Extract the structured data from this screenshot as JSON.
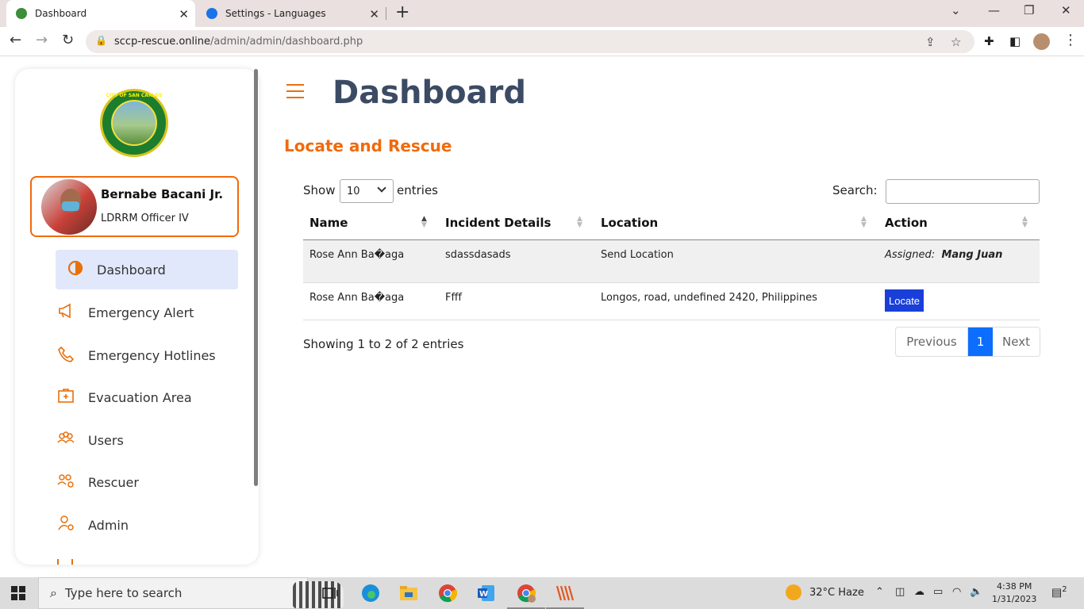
{
  "browser": {
    "tabs": [
      {
        "label": "Dashboard",
        "active": true
      },
      {
        "label": "Settings - Languages",
        "active": false
      }
    ],
    "url_domain": "sccp-rescue.online",
    "url_path": "/admin/admin/dashboard.php"
  },
  "sidebar": {
    "seal_text": "CITY OF SAN CARLOS",
    "user": {
      "name": "Bernabe Bacani Jr.",
      "role": "LDRRM Officer IV"
    },
    "items": [
      {
        "label": "Dashboard",
        "icon": "half-circle-icon",
        "active": true
      },
      {
        "label": "Emergency Alert",
        "icon": "megaphone-icon"
      },
      {
        "label": "Emergency Hotlines",
        "icon": "phone-icon"
      },
      {
        "label": "Evacuation Area",
        "icon": "first-aid-icon"
      },
      {
        "label": "Users",
        "icon": "users-group-icon"
      },
      {
        "label": "Rescuer",
        "icon": "users-gear-icon"
      },
      {
        "label": "Admin",
        "icon": "user-gear-icon"
      }
    ]
  },
  "main": {
    "title": "Dashboard",
    "section_title": "Locate and Rescue",
    "table_controls": {
      "show_label": "Show",
      "entries_value": "10",
      "entries_label": "entries",
      "search_label": "Search:",
      "search_value": ""
    },
    "columns": [
      "Name",
      "Incident Details",
      "Location",
      "Action"
    ],
    "rows": [
      {
        "name": "Rose Ann Ba�aga",
        "details": "sdassdasads",
        "location": "Send Location",
        "action_prefix": "Assigned:",
        "action_name": "Mang Juan"
      },
      {
        "name": "Rose Ann Ba�aga",
        "details": "Ffff",
        "location": "Longos, road, undefined 2420, Philippines",
        "action_button": "Locate"
      }
    ],
    "info": "Showing 1 to 2 of 2 entries",
    "pager": {
      "prev": "Previous",
      "current": "1",
      "next": "Next"
    }
  },
  "taskbar": {
    "search_placeholder": "Type here to search",
    "weather": "32°C  Haze",
    "time": "4:38 PM",
    "date": "1/31/2023",
    "notifications": "2"
  },
  "colors": {
    "accent": "#f06a0c",
    "title": "#3c4b64",
    "active_nav_bg": "#e1e8fb",
    "locate_button": "#1a3fd8",
    "pager_active": "#0d6efd"
  }
}
